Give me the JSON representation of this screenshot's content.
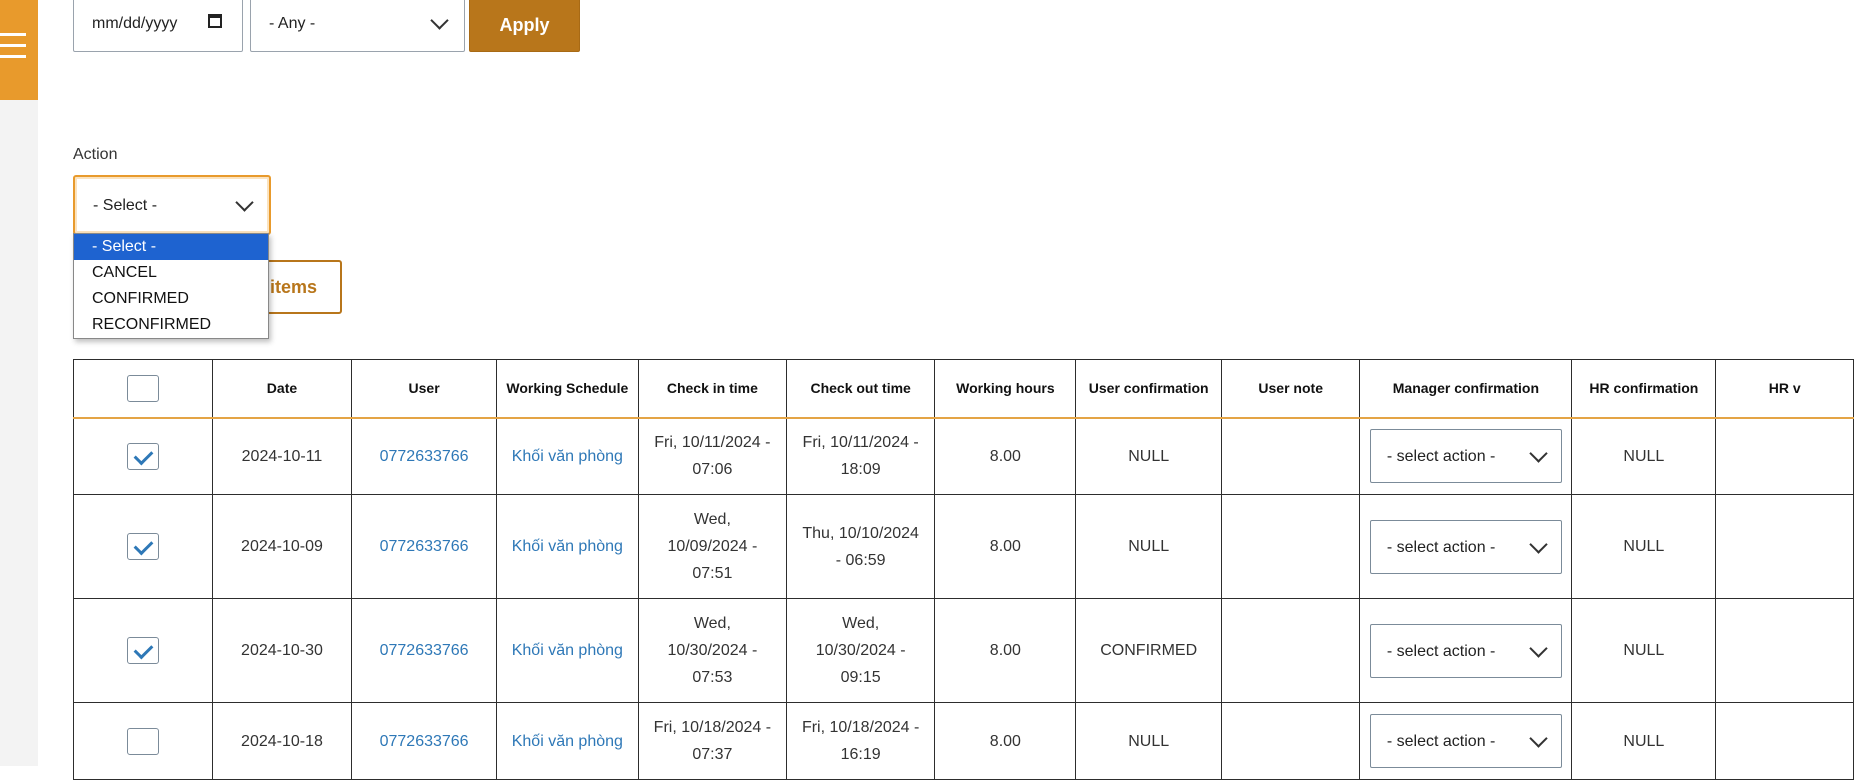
{
  "filters": {
    "date_placeholder": "mm/dd/yyyy",
    "status_value": "- Any -",
    "apply_label": "Apply"
  },
  "bulk": {
    "action_label": "Action",
    "action_value": "- Select -",
    "apply_items_label": "items",
    "options": [
      "- Select -",
      "CANCEL",
      "CONFIRMED",
      "RECONFIRMED"
    ]
  },
  "table": {
    "headers": [
      "Date",
      "User",
      "Working Schedule",
      "Check in time",
      "Check out time",
      "Working hours",
      "User confirmation",
      "User note",
      "Manager confirmation",
      "HR confirmation",
      "HR v"
    ],
    "rows": [
      {
        "checked": true,
        "date": "2024-10-11",
        "user": "0772633766",
        "schedule": "Khối văn phòng",
        "check_in": "Fri, 10/11/2024 - 07:06",
        "check_out": "Fri, 10/11/2024 - 18:09",
        "hours": "8.00",
        "user_conf": "NULL",
        "note": "",
        "manager": "- select action -",
        "hr": "NULL"
      },
      {
        "checked": true,
        "date": "2024-10-09",
        "user": "0772633766",
        "schedule": "Khối văn phòng",
        "check_in": "Wed, 10/09/2024 - 07:51",
        "check_out": "Thu, 10/10/2024 - 06:59",
        "hours": "8.00",
        "user_conf": "NULL",
        "note": "",
        "manager": "- select action -",
        "hr": "NULL"
      },
      {
        "checked": true,
        "date": "2024-10-30",
        "user": "0772633766",
        "schedule": "Khối văn phòng",
        "check_in": "Wed, 10/30/2024 - 07:53",
        "check_out": "Wed, 10/30/2024 - 09:15",
        "hours": "8.00",
        "user_conf": "CONFIRMED",
        "note": "",
        "manager": "- select action -",
        "hr": "NULL"
      },
      {
        "checked": false,
        "date": "2024-10-18",
        "user": "0772633766",
        "schedule": "Khối văn phòng",
        "check_in": "Fri, 10/18/2024 - 07:37",
        "check_out": "Fri, 10/18/2024 - 16:19",
        "hours": "8.00",
        "user_conf": "NULL",
        "note": "",
        "manager": "- select action -",
        "hr": "NULL"
      }
    ]
  },
  "colors": {
    "accent": "#e89a2c",
    "button": "#b8761b",
    "link": "#2e78b7",
    "selected_option": "#1e63d0"
  }
}
